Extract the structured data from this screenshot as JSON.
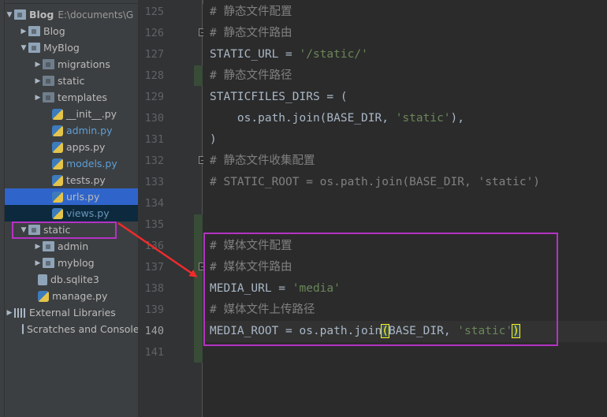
{
  "project_tree": {
    "root": {
      "name": "Blog",
      "path": "E:\\documents\\G"
    },
    "items": [
      {
        "label": "Blog",
        "kind": "folder",
        "depth": 1,
        "expanded": false
      },
      {
        "label": "MyBlog",
        "kind": "folder",
        "depth": 1,
        "expanded": true
      },
      {
        "label": "migrations",
        "kind": "folder",
        "depth": 2,
        "expanded": false
      },
      {
        "label": "static",
        "kind": "folder",
        "depth": 2,
        "expanded": false
      },
      {
        "label": "templates",
        "kind": "folder",
        "depth": 2,
        "expanded": false
      },
      {
        "label": "__init__.py",
        "kind": "py",
        "depth": 2
      },
      {
        "label": "admin.py",
        "kind": "py",
        "depth": 2
      },
      {
        "label": "apps.py",
        "kind": "py",
        "depth": 2
      },
      {
        "label": "models.py",
        "kind": "py",
        "depth": 2
      },
      {
        "label": "tests.py",
        "kind": "py",
        "depth": 2
      },
      {
        "label": "urls.py",
        "kind": "py",
        "depth": 2
      },
      {
        "label": "views.py",
        "kind": "py",
        "depth": 2
      },
      {
        "label": "static",
        "kind": "folder",
        "depth": 1,
        "expanded": true
      },
      {
        "label": "admin",
        "kind": "folder",
        "depth": 2,
        "expanded": false
      },
      {
        "label": "myblog",
        "kind": "folder",
        "depth": 2,
        "expanded": false
      },
      {
        "label": "db.sqlite3",
        "kind": "db",
        "depth": 1
      },
      {
        "label": "manage.py",
        "kind": "py",
        "depth": 1
      },
      {
        "label": "External Libraries",
        "kind": "lib",
        "depth": 0
      },
      {
        "label": "Scratches and Console",
        "kind": "scratch",
        "depth": 0
      }
    ]
  },
  "editor": {
    "line_numbers": [
      "125",
      "126",
      "127",
      "128",
      "129",
      "130",
      "131",
      "132",
      "133",
      "134",
      "135",
      "136",
      "137",
      "138",
      "139",
      "140",
      "141"
    ],
    "lines": {
      "l125": "# 静态文件配置",
      "l126": "# 静态文件路由",
      "l127_a": "STATIC_URL = ",
      "l127_b": "'/static/'",
      "l128": "# 静态文件路径",
      "l129": "STATICFILES_DIRS = (",
      "l130_a": "    os.path.join(BASE_DIR, ",
      "l130_b": "'static'",
      "l130_c": "),",
      "l131": ")",
      "l132": "# 静态文件收集配置",
      "l133": "# STATIC_ROOT = os.path.join(BASE_DIR, 'static')",
      "l136": "# 媒体文件配置",
      "l137": "# 媒体文件路由",
      "l138_a": "MEDIA_URL = ",
      "l138_b": "'media'",
      "l139": "# 媒体文件上传路径",
      "l140_a": "MEDIA_ROOT = os.path.join",
      "l140_b": "(",
      "l140_c": "BASE_DIR, ",
      "l140_d": "'static'",
      "l140_e": ")"
    }
  },
  "colors": {
    "annotation": "#b532c4",
    "arrow": "#ef2b2b",
    "comment": "#808080",
    "string": "#6a8759",
    "identifier": "#a9b7c6"
  }
}
